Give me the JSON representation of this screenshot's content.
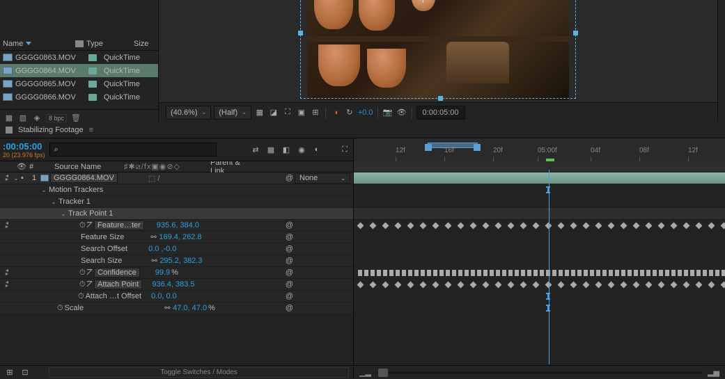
{
  "project": {
    "columns": {
      "name": "Name",
      "type": "Type",
      "size": "Size"
    },
    "items": [
      {
        "name": "GGGG0863.MOV",
        "type": "QuickTime"
      },
      {
        "name": "GGGG0864.MOV",
        "type": "QuickTime"
      },
      {
        "name": "GGGG0865.MOV",
        "type": "QuickTime"
      },
      {
        "name": "GGGG0866.MOV",
        "type": "QuickTime"
      }
    ],
    "bpc": "8 bpc"
  },
  "preview": {
    "zoom": "(40.6%)",
    "resolution": "(Half)",
    "exposure": "+0.0",
    "timecode": "0:00:05:00"
  },
  "timeline": {
    "tab": "Stabilizing Footage",
    "time": ":00:05:00",
    "fps": "20 (23.976 fps)",
    "search_placeholder": "⌕",
    "columns": {
      "source": "Source Name",
      "parent": "Parent & Link"
    },
    "layer": {
      "index": "1",
      "name": "GGGG0864.MOV",
      "parent": "None"
    },
    "trackers_label": "Motion Trackers",
    "tracker1_label": "Tracker 1",
    "trackpoint_label": "Track Point 1",
    "props": {
      "feature_center": {
        "label": "Feature…ter",
        "value": "935.6, 384.0"
      },
      "feature_size": {
        "label": "Feature Size",
        "value": "169.4, 262.8"
      },
      "search_offset": {
        "label": "Search Offset",
        "value": "0.0 ,-0.0"
      },
      "search_size": {
        "label": "Search Size",
        "value": "295.2, 382.3"
      },
      "confidence": {
        "label": "Confidence",
        "value": "99.9",
        "unit": " %"
      },
      "attach_point": {
        "label": "Attach Point",
        "value": "936.4, 383.5"
      },
      "attach_offset": {
        "label": "Attach …t Offset",
        "value": "0.0, 0.0"
      },
      "scale": {
        "label": "Scale",
        "value": "47.0, 47.0",
        "unit": " %"
      }
    },
    "ruler_ticks": [
      "12f",
      "16f",
      "20f",
      "05:00f",
      "04f",
      "08f",
      "12f"
    ],
    "toggle_label": "Toggle Switches / Modes"
  }
}
